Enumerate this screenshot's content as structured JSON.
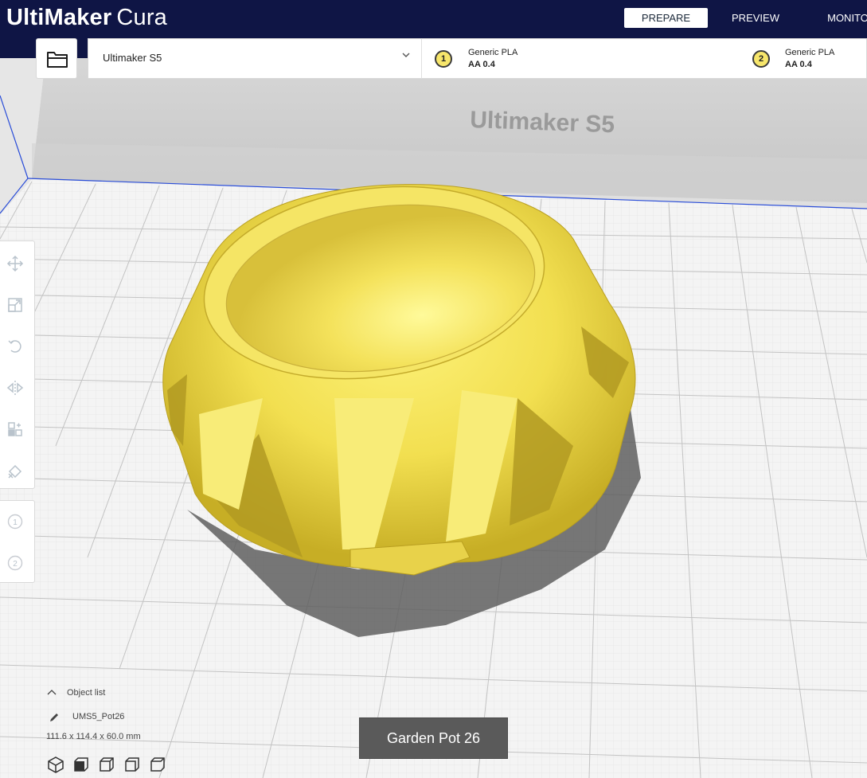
{
  "brand": {
    "name_bold": "UltiMaker",
    "name_light": "Cura"
  },
  "stages": {
    "prepare": "PREPARE",
    "preview": "PREVIEW",
    "monitor": "MONITO"
  },
  "printer": {
    "name": "Ultimaker S5",
    "bed_label": "Ultimaker S5"
  },
  "extruders": [
    {
      "number": "1",
      "material": "Generic PLA",
      "core": "AA 0.4"
    },
    {
      "number": "2",
      "material": "Generic PLA",
      "core": "AA 0.4"
    }
  ],
  "tools": [
    "move-icon",
    "scale-icon",
    "rotate-icon",
    "mirror-icon",
    "per-model-settings-icon",
    "support-blocker-icon"
  ],
  "extruder_tools": {
    "one": "1",
    "two": "2"
  },
  "object_list": {
    "toggle_label": "Object list",
    "object_name": "UMS5_Pot26",
    "dimensions": "111.6 x 114.4 x 60.0 mm"
  },
  "tooltip": {
    "text": "Garden Pot 26"
  },
  "colors": {
    "header_bg": "#0f1545",
    "model_yellow": "#f2e155",
    "model_shade": "#c9b32a",
    "bed_bg": "#f3f3f3",
    "grid_line": "#c8c8c8",
    "material_badge": "#f7e66b"
  }
}
